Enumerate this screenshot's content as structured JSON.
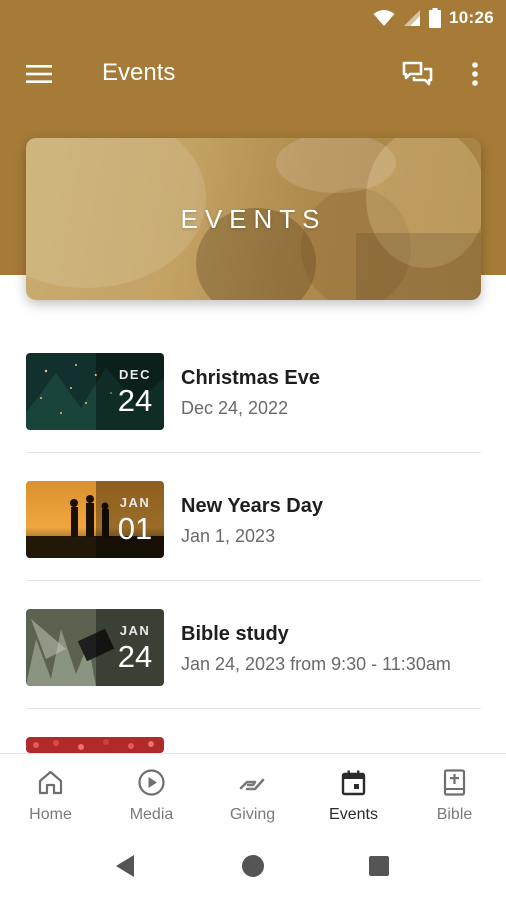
{
  "status_bar": {
    "time": "10:26"
  },
  "app_bar": {
    "title": "Events"
  },
  "banner": {
    "title": "EVENTS"
  },
  "events": [
    {
      "month": "DEC",
      "day": "24",
      "name": "Christmas Eve",
      "date": "Dec 24, 2022"
    },
    {
      "month": "JAN",
      "day": "01",
      "name": "New Years Day",
      "date": "Jan 1, 2023"
    },
    {
      "month": "JAN",
      "day": "24",
      "name": "Bible study",
      "date": "Jan 24, 2023 from 9:30 - 11:30am"
    }
  ],
  "bottom_nav": [
    {
      "label": "Home",
      "icon": "home-icon"
    },
    {
      "label": "Media",
      "icon": "play-circle-icon"
    },
    {
      "label": "Giving",
      "icon": "giving-hand-icon"
    },
    {
      "label": "Events",
      "icon": "calendar-icon",
      "active": true
    },
    {
      "label": "Bible",
      "icon": "bible-icon"
    }
  ],
  "colors": {
    "header": "#a57b37",
    "active_nav": "#2b2b2b",
    "inactive_nav": "#7a7a7a"
  }
}
